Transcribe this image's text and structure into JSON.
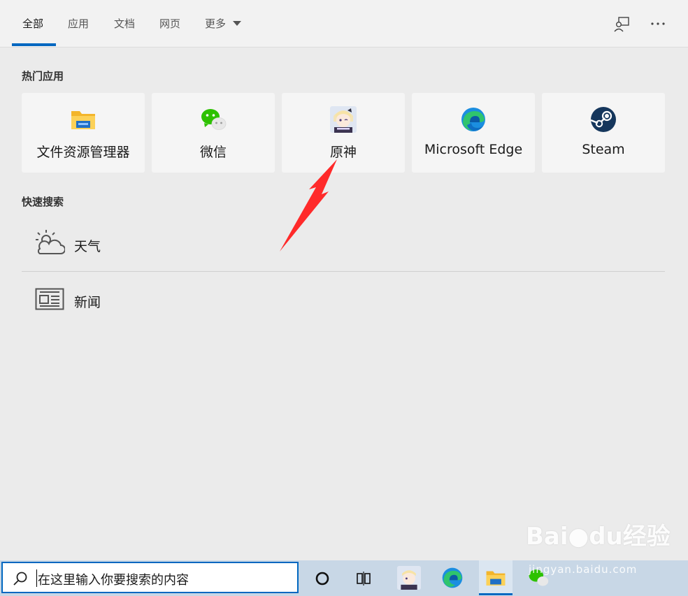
{
  "tabs": [
    {
      "label": "全部"
    },
    {
      "label": "应用"
    },
    {
      "label": "文档"
    },
    {
      "label": "网页"
    },
    {
      "label": "更多"
    }
  ],
  "sections": {
    "top_apps": "热门应用",
    "quick_search": "快速搜索"
  },
  "apps": [
    {
      "label": "文件资源管理器",
      "icon": "folder-icon"
    },
    {
      "label": "微信",
      "icon": "wechat-icon"
    },
    {
      "label": "原神",
      "icon": "genshin-icon"
    },
    {
      "label": "Microsoft Edge",
      "icon": "edge-icon"
    },
    {
      "label": "Steam",
      "icon": "steam-icon"
    }
  ],
  "quick": [
    {
      "label": "天气",
      "icon": "weather-icon"
    },
    {
      "label": "新闻",
      "icon": "news-icon"
    }
  ],
  "taskbar": {
    "search_text": "在这里输入你要搜索的内容"
  },
  "watermark": {
    "brand": "Bai",
    "brand2": "du",
    "cn": "经验",
    "url": "jingyan.baidu.com"
  },
  "colors": {
    "accent": "#0067c0",
    "arrow": "#ff2a2a"
  }
}
